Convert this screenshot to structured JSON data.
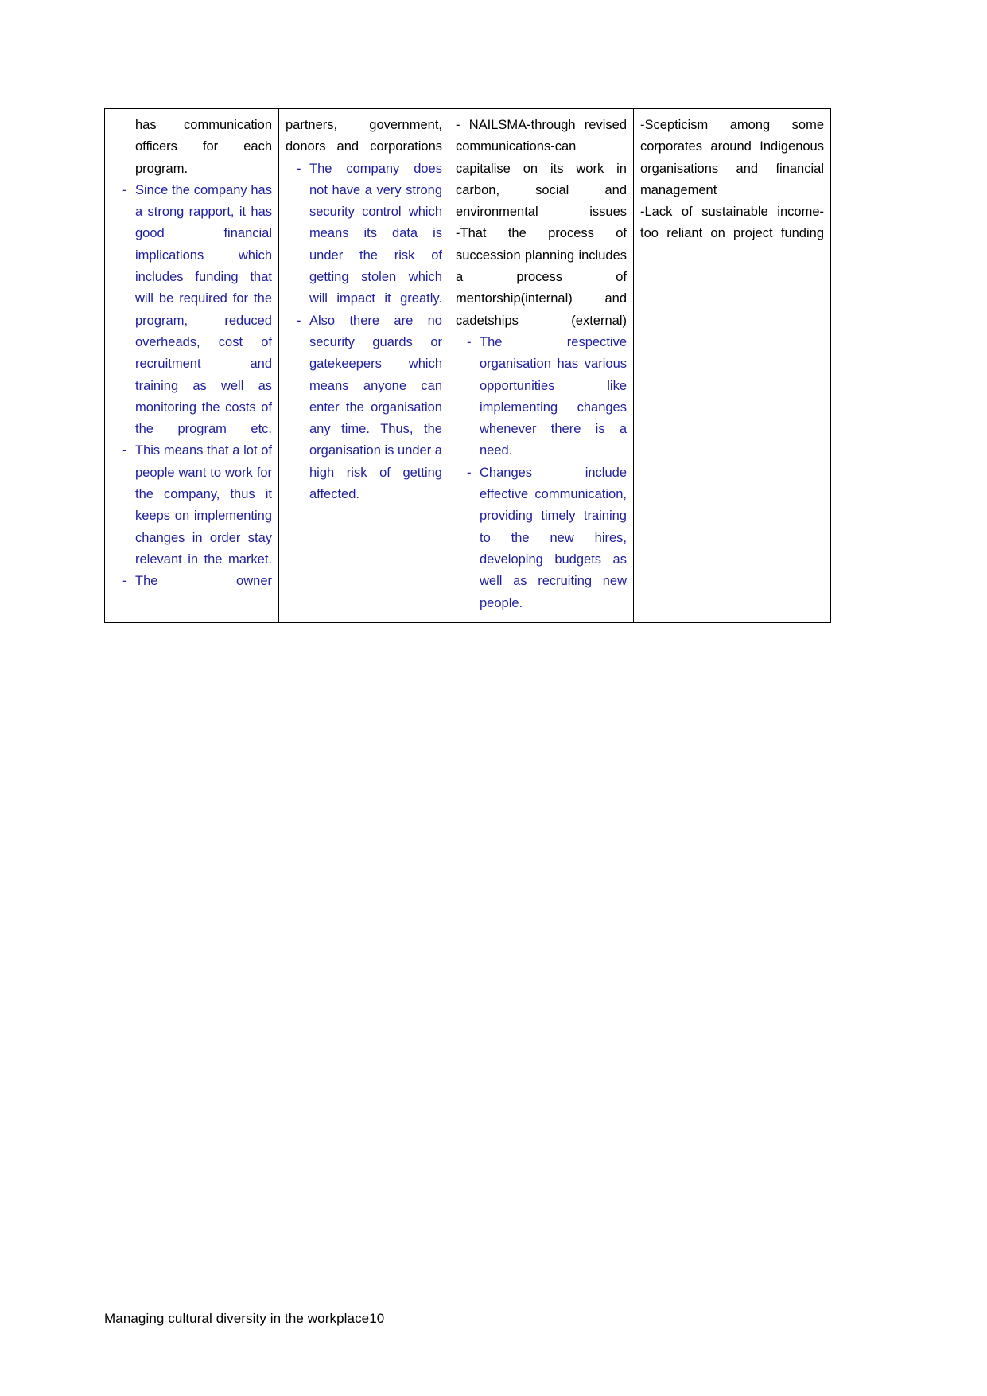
{
  "document": {
    "footer_text": "Managing cultural diversity in the workplace10",
    "colors": {
      "body_black": "#000000",
      "body_blue": "#1f1f9e",
      "border": "#000000",
      "page_background": "#ffffff"
    }
  },
  "table": {
    "columns": [
      {
        "id": "column-1",
        "blocks": [
          {
            "id": "c1-b1",
            "color": "black",
            "style": "continuation",
            "text": "has communication officers for each program."
          },
          {
            "id": "c1-b2",
            "color": "blue",
            "style": "bullet",
            "marker": "-",
            "text": "Since the company has a strong rapport, it has good financial implications which includes funding that will be required for the program, reduced overheads, cost of recruitment and training as well as monitoring the costs of the program etc."
          },
          {
            "id": "c1-b3",
            "color": "blue",
            "style": "bullet",
            "marker": "-",
            "text": "This means that a lot of people want to work for the company, thus it keeps on implementing changes in order stay relevant in the market."
          },
          {
            "id": "c1-b4",
            "color": "blue",
            "style": "bullet",
            "marker": "-",
            "text": "The owner"
          }
        ]
      },
      {
        "id": "column-2",
        "blocks": [
          {
            "id": "c2-b1",
            "color": "black",
            "style": "plain",
            "text": "partners, government, donors and corporations"
          },
          {
            "id": "c2-b2",
            "color": "blue",
            "style": "bullet",
            "marker": "-",
            "text": "The company does not have a very strong security control which means its data is under the risk of getting stolen which will impact it greatly."
          },
          {
            "id": "c2-b3",
            "color": "blue",
            "style": "bullet",
            "marker": "-",
            "text": "Also there are no security guards or gatekeepers which means anyone can enter the organisation any time. Thus, the organisation is under a high risk of getting affected."
          }
        ]
      },
      {
        "id": "column-3",
        "blocks": [
          {
            "id": "c3-b1",
            "color": "black",
            "style": "inline-dash",
            "text": "-   NAILSMA-through revised communications-can capitalise on its work in carbon, social and environmental issues"
          },
          {
            "id": "c3-b2",
            "color": "black",
            "style": "plain",
            "text": "-That the process of succession planning includes a process of mentorship(internal) and cadetships (external)"
          },
          {
            "id": "c3-b3",
            "color": "blue",
            "style": "bullet",
            "marker": "-",
            "text": "The respective organisation has various opportunities like implementing changes whenever there is a need."
          },
          {
            "id": "c3-b4",
            "color": "blue",
            "style": "bullet",
            "marker": "-",
            "text": "Changes include effective communication, providing timely training to the new hires, developing budgets as well as recruiting new people."
          }
        ]
      },
      {
        "id": "column-4",
        "blocks": [
          {
            "id": "c4-b1",
            "color": "black",
            "style": "plain",
            "text": "-Scepticism among some corporates around Indigenous organisations and financial management"
          },
          {
            "id": "c4-b2",
            "color": "black",
            "style": "plain",
            "text": "-Lack of sustainable income-too reliant on project funding"
          }
        ]
      }
    ]
  }
}
